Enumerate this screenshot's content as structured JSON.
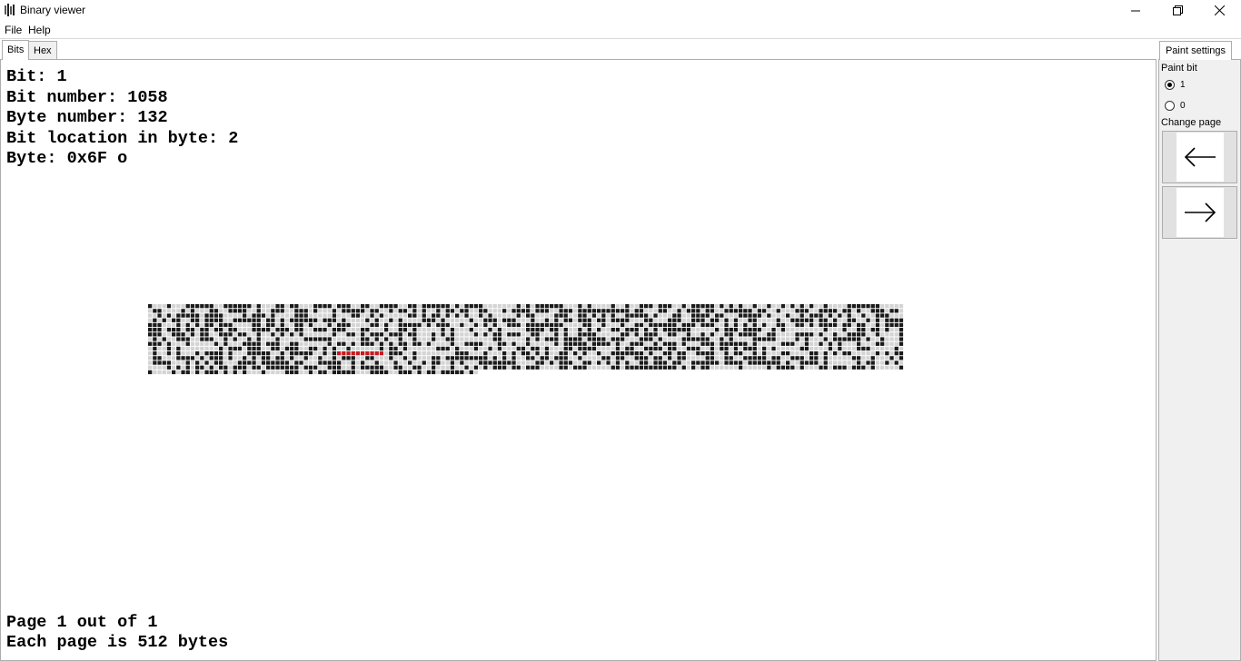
{
  "window": {
    "title": "Binary viewer"
  },
  "menu": {
    "items": [
      "File",
      "Help"
    ]
  },
  "tabs": {
    "left": [
      "Bits",
      "Hex"
    ],
    "active": "Bits"
  },
  "info": {
    "bit": "Bit: 1",
    "bit_number": "Bit number: 1058",
    "byte_number": "Byte number: 132",
    "bit_location": "Bit location in byte: 2",
    "byte": "Byte: 0x6F o"
  },
  "footer": {
    "page": "Page 1 out of 1",
    "page_size": "Each page is 512 bytes"
  },
  "bit_grid": {
    "total_bits": 4096,
    "bytes_per_page": 512,
    "highlighted_byte": 132,
    "colors": {
      "one": "#1a1a1a",
      "zero": "#d4d4d4",
      "highlight": "#c8191f",
      "background": "#ffffff"
    }
  },
  "paint_settings": {
    "tab_label": "Paint settings",
    "paint_bit_label": "Paint bit",
    "options": [
      "1",
      "0"
    ],
    "selected": "1",
    "change_page_label": "Change page",
    "prev_icon": "arrow-left-icon",
    "next_icon": "arrow-right-icon"
  }
}
